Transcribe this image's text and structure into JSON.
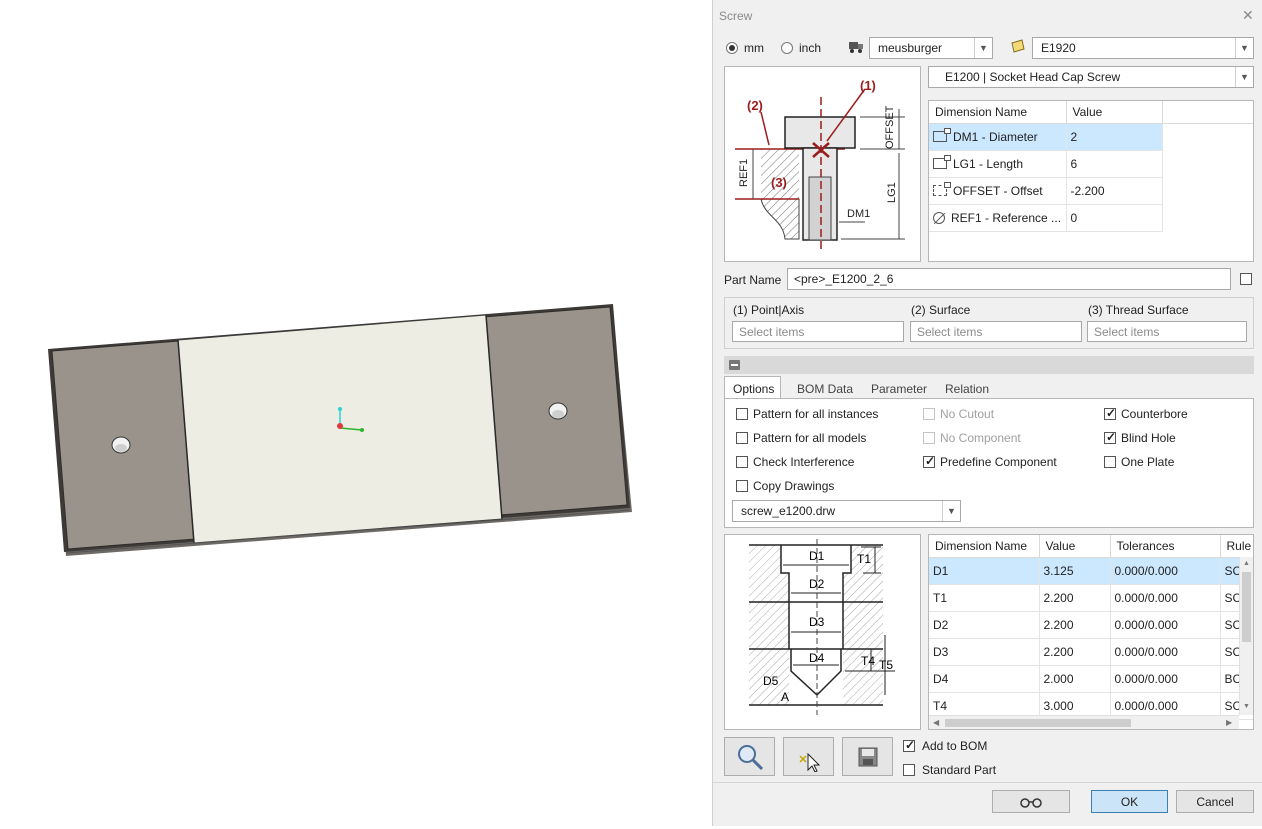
{
  "dialog": {
    "title": "Screw",
    "close_icon": "close-icon"
  },
  "units": {
    "mm_label": "mm",
    "inch_label": "inch",
    "selected": "mm"
  },
  "catalog": {
    "supplier_icon": "truck-icon",
    "supplier": "meusburger",
    "plate_icon": "plate-icon",
    "plate": "E1920",
    "type": "E1200 | Socket Head Cap Screw"
  },
  "screw_diagram": {
    "labels": {
      "p1": "(1)",
      "p2": "(2)",
      "p3": "(3)",
      "offset": "OFFSET",
      "ref1": "REF1",
      "lg1": "LG1",
      "dm1": "DM1"
    }
  },
  "dimensions": {
    "headers": [
      "Dimension Name",
      "Value"
    ],
    "rows": [
      {
        "icon": "dimension-icon",
        "name": "DM1 - Diameter",
        "value": "2"
      },
      {
        "icon": "dimension-icon",
        "name": "LG1 - Length",
        "value": "6"
      },
      {
        "icon": "offset-icon",
        "name": "OFFSET - Offset",
        "value": "-2.200"
      },
      {
        "icon": "reference-icon",
        "name": "REF1 - Reference ...",
        "value": "0"
      }
    ]
  },
  "part_name": {
    "label": "Part Name",
    "value": "<pre>_E1200_2_6"
  },
  "references": {
    "point_axis": {
      "label": "(1) Point|Axis",
      "placeholder": "Select items"
    },
    "surface": {
      "label": "(2) Surface",
      "placeholder": "Select items"
    },
    "thread_surface": {
      "label": "(3) Thread Surface",
      "placeholder": "Select items"
    }
  },
  "tabs": [
    {
      "label": "Options",
      "active": true
    },
    {
      "label": "BOM Data",
      "active": false
    },
    {
      "label": "Parameter",
      "active": false
    },
    {
      "label": "Relation",
      "active": false
    }
  ],
  "options": {
    "pattern_all_instances": {
      "label": "Pattern for all instances",
      "checked": false
    },
    "pattern_all_models": {
      "label": "Pattern for all models",
      "checked": false
    },
    "check_interference": {
      "label": "Check Interference",
      "checked": false
    },
    "copy_drawings": {
      "label": "Copy Drawings",
      "checked": false
    },
    "no_cutout": {
      "label": "No Cutout",
      "checked": false,
      "disabled": true
    },
    "no_component": {
      "label": "No Component",
      "checked": false,
      "disabled": true
    },
    "predefine_component": {
      "label": "Predefine Component",
      "checked": true
    },
    "counterbore": {
      "label": "Counterbore",
      "checked": true
    },
    "blind_hole": {
      "label": "Blind Hole",
      "checked": true
    },
    "one_plate": {
      "label": "One Plate",
      "checked": false
    },
    "drawing_file": "screw_e1200.drw"
  },
  "hole_diagram": {
    "labels": {
      "d1": "D1",
      "d2": "D2",
      "d3": "D3",
      "d4": "D4",
      "d5": "D5",
      "t1": "T1",
      "t4": "T4",
      "t5": "T5",
      "a": "A"
    }
  },
  "hole_dimensions": {
    "headers": [
      "Dimension Name",
      "Value",
      "Tolerances",
      "Rule"
    ],
    "rows": [
      {
        "name": "D1",
        "value": "3.125",
        "tol": "0.000/0.000",
        "rule": "SC"
      },
      {
        "name": "T1",
        "value": "2.200",
        "tol": "0.000/0.000",
        "rule": "SC"
      },
      {
        "name": "D2",
        "value": "2.200",
        "tol": "0.000/0.000",
        "rule": "SC"
      },
      {
        "name": "D3",
        "value": "2.200",
        "tol": "0.000/0.000",
        "rule": "SC"
      },
      {
        "name": "D4",
        "value": "2.000",
        "tol": "0.000/0.000",
        "rule": "BC"
      },
      {
        "name": "T4",
        "value": "3.000",
        "tol": "0.000/0.000",
        "rule": "SC"
      }
    ]
  },
  "bottom": {
    "add_to_bom": {
      "label": "Add to BOM",
      "checked": true
    },
    "standard_part": {
      "label": "Standard Part",
      "checked": false
    },
    "zoom_icon": "magnifier-icon",
    "pick_icon": "pick-cursor-icon",
    "save_icon": "save-icon"
  },
  "footer": {
    "preview_icon": "glasses-icon",
    "ok_label": "OK",
    "cancel_label": "Cancel"
  },
  "colors": {
    "selection": "#cce8ff",
    "plate_dark": "#9a938c",
    "plate_light": "#eeede3",
    "callout_red": "#9b1c1c"
  }
}
